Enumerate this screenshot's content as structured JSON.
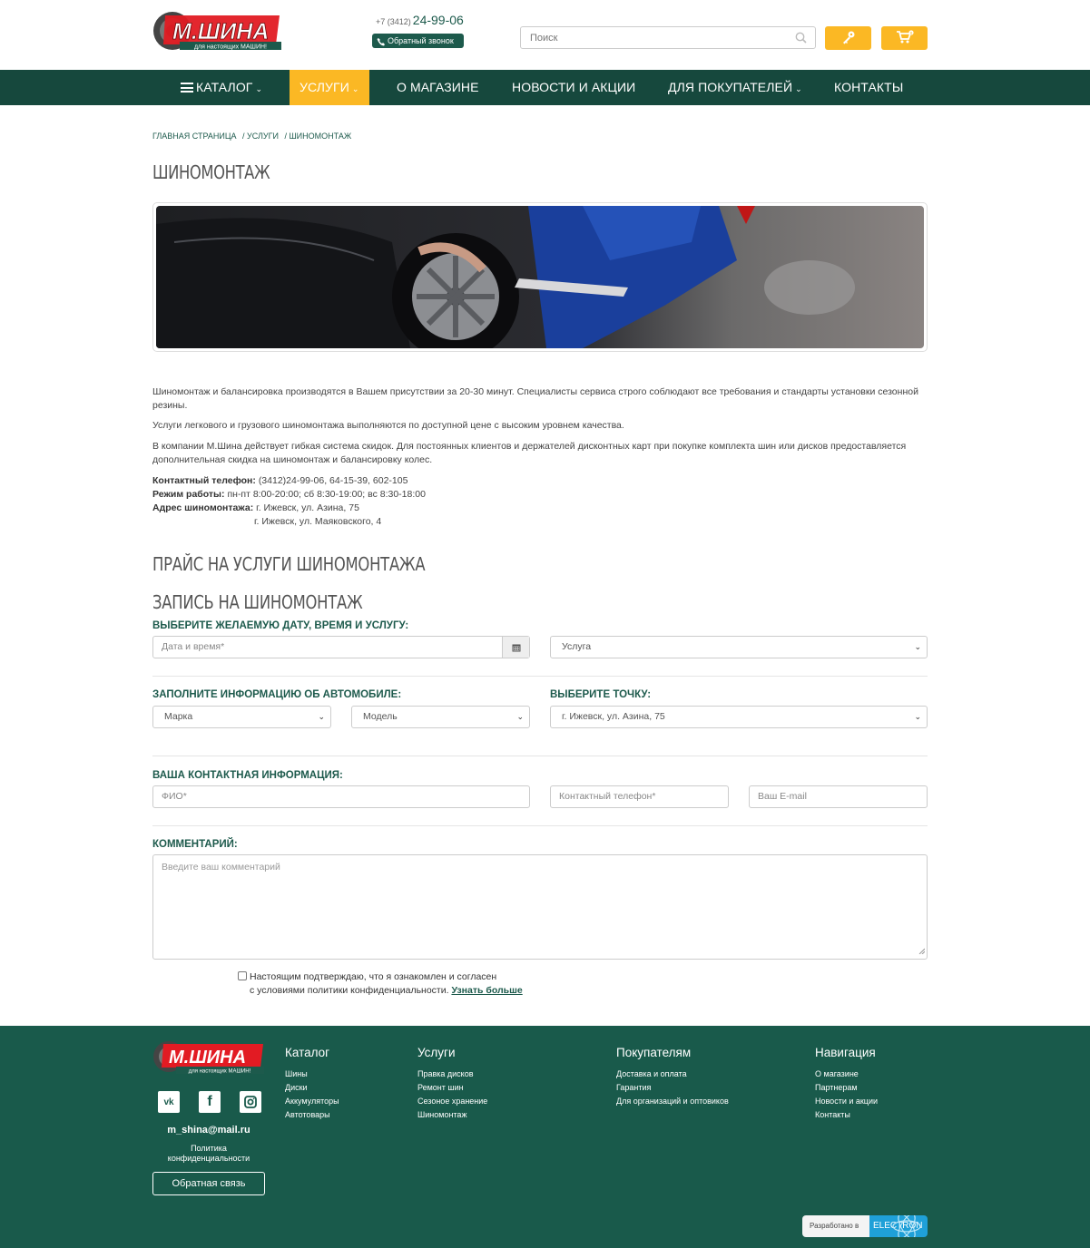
{
  "header": {
    "logo_text": "М.ШИНА",
    "logo_tagline": "для настоящих МАШИН!",
    "phone_code": "+7 (3412)",
    "phone_number": "24-99-06",
    "callback_label": "Обратный звонок",
    "search_placeholder": "Поиск"
  },
  "nav": {
    "items": [
      {
        "label": "КАТАЛОГ"
      },
      {
        "label": "УСЛУГИ"
      },
      {
        "label": "О МАГАЗИНЕ"
      },
      {
        "label": "НОВОСТИ И АКЦИИ"
      },
      {
        "label": "ДЛЯ ПОКУПАТЕЛЕЙ"
      },
      {
        "label": "КОНТАКТЫ"
      }
    ],
    "active_color": "#fbb824",
    "bg_color": "#16483d"
  },
  "breadcrumbs": [
    "ГЛАВНАЯ СТРАНИЦА",
    "/ УСЛУГИ",
    "/ ШИНОМОНТАЖ"
  ],
  "page_title": "ШИНОМОНТАЖ",
  "content": {
    "p1": "Шиномонтаж и балансировка производятся в Вашем присутствии за 20-30 минут. Специалисты сервиса строго соблюдают все требования и стандарты установки сезонной резины.",
    "p2": "Услуги легкового и грузового шиномонтажа выполняются по доступной цене с высоким уровнем качества.",
    "p3": "В компании М.Шина действует гибкая система скидок. Для постоянных клиентов и держателей дисконтных карт при покупке комплекта шин или дисков предоставляется дополнительная скидка на шиномонтаж и балансировку колес.",
    "phone_label": "Контактный телефон:",
    "phone_value": "(3412)24-99-06, 64-15-39, 602-105",
    "hours_label": "Режим работы:",
    "hours_value": "пн-пт 8:00-20:00; сб 8:30-19:00; вс 8:30-18:00",
    "address_label": "Адрес шиномонтажа:",
    "address_1": "г. Ижевск, ул. Азина, 75",
    "address_2": "г. Ижевск, ул. Маяковского, 4"
  },
  "price_title": "ПРАЙС НА УСЛУГИ ШИНОМОНТАЖА",
  "form": {
    "title": "ЗАПИСЬ НА ШИНОМОНТАЖ",
    "date_section": "ВЫБЕРИТЕ ЖЕЛАЕМУЮ ДАТУ, ВРЕМЯ И УСЛУГУ:",
    "date_placeholder": "Дата и время*",
    "service_select": "Услуга",
    "car_section": "ЗАПОЛНИТЕ ИНФОРМАЦИЮ ОБ АВТОМОБИЛЕ:",
    "brand_select": "Марка",
    "model_select": "Модель",
    "point_section": "ВЫБЕРИТЕ ТОЧКУ:",
    "point_select": "г. Ижевск, ул. Азина, 75",
    "contact_section": "ВАША КОНТАКТНАЯ ИНФОРМАЦИЯ:",
    "name_placeholder": "ФИО*",
    "phone_placeholder": "Контактный телефон*",
    "email_placeholder": "Ваш E-mail",
    "comment_section": "КОММЕНТАРИЙ:",
    "comment_placeholder": "Введите ваш комментарий",
    "agree_line1": "Настоящим подтверждаю, что я ознакомлен и согласен",
    "agree_line2": "с условиями политики конфиденциальности.",
    "agree_link": "Узнать больше"
  },
  "footer": {
    "email": "m_shina@mail.ru",
    "policy": "Политика конфиденциальности",
    "feedback_button": "Обратная связь",
    "columns": [
      {
        "title": "Каталог",
        "links": [
          "Шины",
          "Диски",
          "Аккумуляторы",
          "Автотовары"
        ]
      },
      {
        "title": "Услуги",
        "links": [
          "Правка дисков",
          "Ремонт шин",
          "Сезоное хранение",
          "Шиномонтаж"
        ]
      },
      {
        "title": "Покупателям",
        "links": [
          "Доставка и оплата",
          "Гарантия",
          "Для организаций и оптовиков"
        ]
      },
      {
        "title": "Навигация",
        "links": [
          "О магазине",
          "Партнерам",
          "Новости и акции",
          "Контакты"
        ]
      }
    ],
    "developer_label": "Разработано в",
    "developer_name": "ELECTRON",
    "bg_color": "#195a4b"
  }
}
